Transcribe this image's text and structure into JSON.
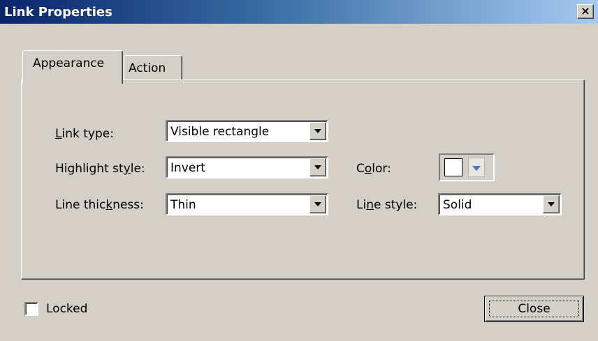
{
  "window": {
    "title": "Link Properties",
    "close_glyph": "×"
  },
  "tabs": [
    {
      "label": "Appearance",
      "active": true
    },
    {
      "label": "Action",
      "active": false
    }
  ],
  "appearance": {
    "link_type": {
      "label_pre": "",
      "label_u": "L",
      "label_post": "ink type:",
      "value": "Visible rectangle"
    },
    "highlight_style": {
      "label_pre": "Highlight st",
      "label_u": "y",
      "label_post": "le:",
      "value": "Invert"
    },
    "line_thickness": {
      "label_pre": "Line thic",
      "label_u": "k",
      "label_post": "ness:",
      "value": "Thin"
    },
    "color": {
      "label_pre": "C",
      "label_u": "o",
      "label_post": "lor:",
      "swatch": "#ffffff",
      "accent": "#4a74c9",
      "icon": "chevron-down-icon"
    },
    "line_style": {
      "label_pre": "Li",
      "label_u": "n",
      "label_post": "e style:",
      "value": "Solid"
    }
  },
  "footer": {
    "locked": {
      "label": "Locked",
      "checked": false
    },
    "close_label": "Close"
  }
}
